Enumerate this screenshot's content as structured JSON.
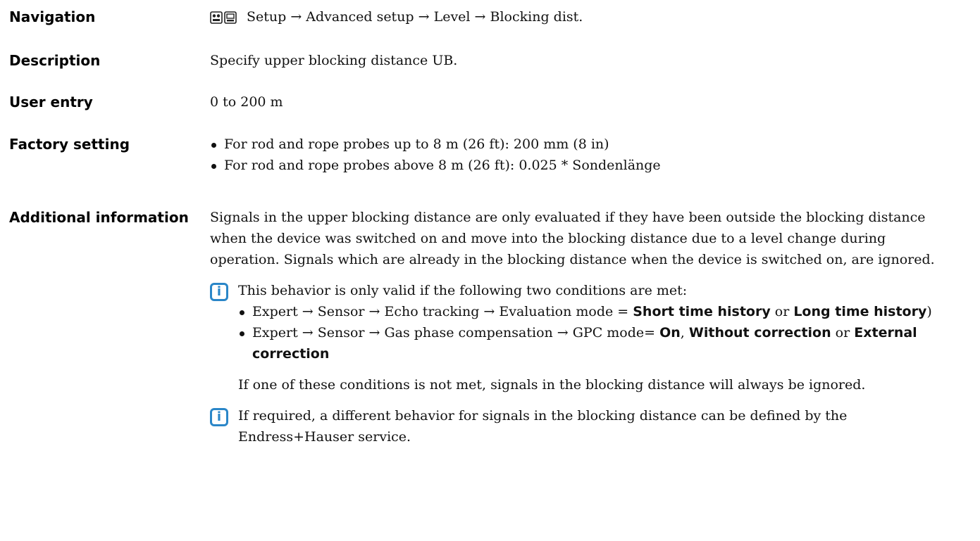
{
  "navigation": {
    "label": "Navigation",
    "icons": [
      "display-operation-icon",
      "display-icon"
    ],
    "path": "Setup → Advanced setup → Level → Blocking dist."
  },
  "description": {
    "label": "Description",
    "text": "Specify upper blocking distance UB."
  },
  "user_entry": {
    "label": "User entry",
    "text": "0 to 200 m"
  },
  "factory_setting": {
    "label": "Factory setting",
    "items": [
      "For rod and rope probes up to 8 m (26 ft): 200 mm (8 in)",
      "For rod and rope probes above 8 m (26 ft): 0.025 * Sondenlänge"
    ]
  },
  "additional_information": {
    "label": "Additional information",
    "paragraph": "Signals in the upper blocking distance are only evaluated if they have been outside the blocking distance when the device was switched on and move into the blocking distance due to a level change during operation. Signals which are already in the blocking distance when the device is switched on, are ignored.",
    "note1": {
      "intro": "This behavior is only valid if the following two conditions are met:",
      "cond1": {
        "prefix": "Expert → Sensor → Echo tracking → Evaluation mode = ",
        "bold1": "Short time history",
        "mid": " or ",
        "bold2": "Long time history",
        "suffix": ")"
      },
      "cond2": {
        "prefix": "Expert → Sensor → Gas phase compensation → GPC mode= ",
        "bold1": "On",
        "sep": ", ",
        "bold2": "Without correction",
        "mid": " or ",
        "bold3": "External correction"
      },
      "closing": "If one of these conditions is not met, signals in the blocking distance will always be ignored."
    },
    "note2": {
      "text": "If required, a different behavior for signals in the blocking distance can be defined by the Endress+Hauser service."
    },
    "note_icon_glyph": "i",
    "note_icon_color": "#2a86c8"
  }
}
